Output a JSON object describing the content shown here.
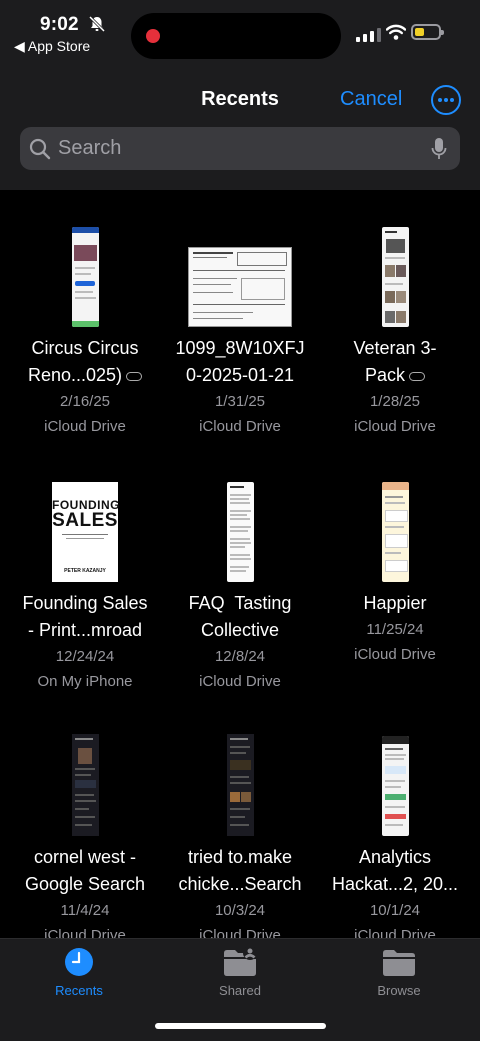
{
  "status": {
    "time": "9:02",
    "back_app": "◀ App Store"
  },
  "header": {
    "title": "Recents",
    "cancel_label": "Cancel",
    "more_icon": "more-circle-icon"
  },
  "search": {
    "placeholder": "Search",
    "value": ""
  },
  "files": [
    {
      "name_line1": "Circus Circus",
      "name_line2": "Reno...025)",
      "icloud_pending": true,
      "date": "2/16/25",
      "location": "iCloud Drive"
    },
    {
      "name_line1": "1099_8W10XFJ",
      "name_line2": "0-2025-01-21",
      "icloud_pending": false,
      "date": "1/31/25",
      "location": "iCloud Drive"
    },
    {
      "name_line1": "Veteran 3-",
      "name_line2": "Pack",
      "icloud_pending": true,
      "date": "1/28/25",
      "location": "iCloud Drive"
    },
    {
      "name_line1": "Founding Sales",
      "name_line2": "- Print...mroad",
      "icloud_pending": false,
      "date": "12/24/24",
      "location": "On My iPhone",
      "cover_title_1": "FOUNDING",
      "cover_title_2": "SALES",
      "cover_author": "PETER KAZANJY"
    },
    {
      "name_line1": "FAQ  Tasting",
      "name_line2": "Collective",
      "icloud_pending": false,
      "date": "12/8/24",
      "location": "iCloud Drive"
    },
    {
      "name_line1": "Happier",
      "name_line2": "",
      "icloud_pending": false,
      "date": "11/25/24",
      "location": "iCloud Drive"
    },
    {
      "name_line1": "cornel west -",
      "name_line2": "Google Search",
      "icloud_pending": false,
      "date": "11/4/24",
      "location": "iCloud Drive"
    },
    {
      "name_line1": "tried to.make",
      "name_line2": "chicke...Search",
      "icloud_pending": false,
      "date": "10/3/24",
      "location": "iCloud Drive"
    },
    {
      "name_line1": "Analytics",
      "name_line2": "Hackat...2, 20...",
      "icloud_pending": false,
      "date": "10/1/24",
      "location": "iCloud Drive"
    }
  ],
  "tabs": [
    {
      "label": "Recents",
      "icon": "clock-icon",
      "active": true
    },
    {
      "label": "Shared",
      "icon": "shared-folder-icon",
      "active": false
    },
    {
      "label": "Browse",
      "icon": "folder-icon",
      "active": false
    }
  ],
  "colors": {
    "accent": "#1e8dff",
    "background": "#000000",
    "bar": "#1c1c1e",
    "secondary_text": "#98989e"
  }
}
